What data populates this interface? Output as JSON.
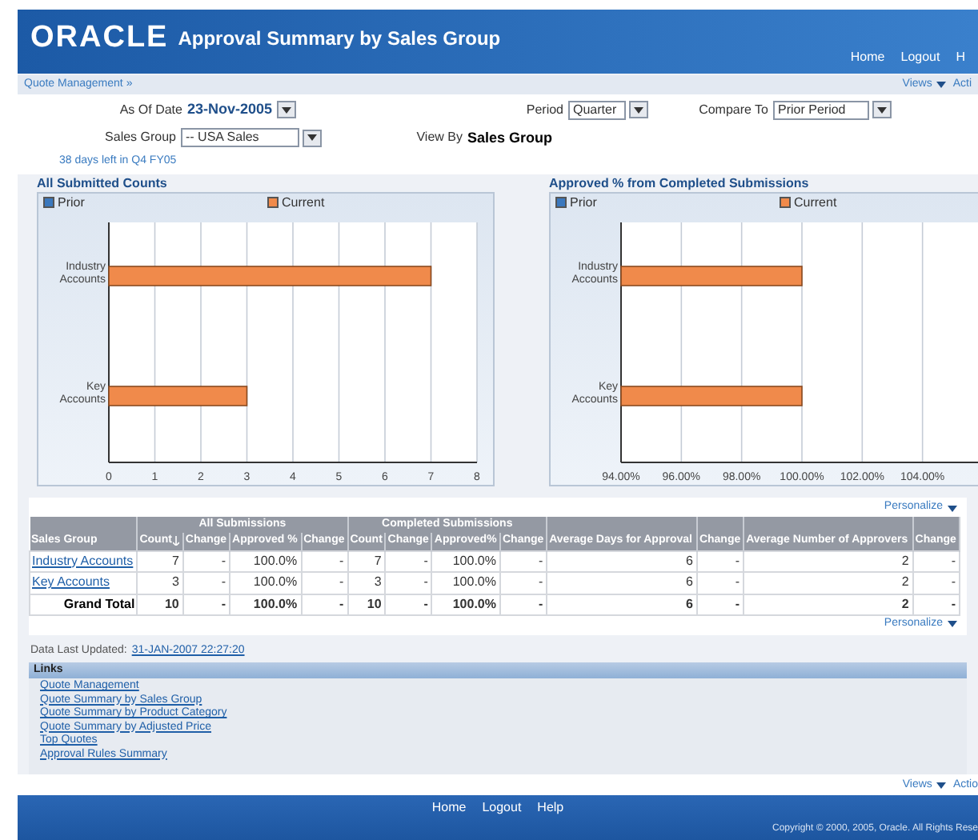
{
  "header": {
    "logo": "ORACLE",
    "title": "Approval Summary by Sales Group",
    "nav": [
      "Home",
      "Logout",
      "H"
    ]
  },
  "breadcrumb": {
    "link": "Quote Management »",
    "views": "Views",
    "actions": "Acti"
  },
  "parameters": {
    "as_of_date": {
      "label": "As Of Date",
      "value": "23-Nov-2005"
    },
    "period": {
      "label": "Period",
      "value": "Quarter"
    },
    "compare_to": {
      "label": "Compare To",
      "value": "Prior Period"
    },
    "sales_group": {
      "label": "Sales Group",
      "value": "-- USA Sales"
    },
    "view_by": {
      "label": "View By",
      "value": "Sales Group"
    }
  },
  "period_note": "38 days left in Q4 FY05",
  "charts": [
    {
      "chart_data": {
        "type": "bar",
        "orientation": "horizontal",
        "grid": true,
        "title": "All Submitted Counts",
        "categories": [
          "Industry Accounts",
          "Key Accounts"
        ],
        "series": [
          {
            "name": "Prior",
            "color": "#3b78bd",
            "values": [
              null,
              null
            ]
          },
          {
            "name": "Current",
            "color": "#f08a4b",
            "values": [
              7,
              3
            ]
          }
        ],
        "xlim": [
          0,
          8
        ],
        "xticks": [
          0,
          1,
          2,
          3,
          4,
          5,
          6,
          7,
          8
        ]
      }
    },
    {
      "chart_data": {
        "type": "bar",
        "orientation": "horizontal",
        "grid": true,
        "title": "Approved % from Completed Submissions",
        "categories": [
          "Industry Accounts",
          "Key Accounts"
        ],
        "series": [
          {
            "name": "Prior",
            "color": "#3b78bd",
            "values": [
              null,
              null
            ]
          },
          {
            "name": "Current",
            "color": "#f08a4b",
            "values": [
              100,
              100
            ]
          }
        ],
        "xlim": [
          94,
          106
        ],
        "xticks": [
          {
            "value": 94,
            "label": "94.00%"
          },
          {
            "value": 96,
            "label": "96.00%"
          },
          {
            "value": 98,
            "label": "98.00%"
          },
          {
            "value": 100,
            "label": "100.00%"
          },
          {
            "value": 102,
            "label": "102.00%"
          },
          {
            "value": 104,
            "label": "104.00%"
          }
        ]
      }
    }
  ],
  "table": {
    "personalize": "Personalize",
    "personalize_bottom": "Personalize",
    "group_headers": [
      {
        "label": "All Submissions"
      },
      {
        "label": "Completed Submissions"
      }
    ],
    "columns": [
      {
        "label": "Sales Group",
        "sorted": false,
        "grouped": false
      },
      {
        "label": "Count",
        "sorted": true,
        "grouped": true,
        "group_start": true
      },
      {
        "label": "Change",
        "sorted": false,
        "grouped": true,
        "group_start": false
      },
      {
        "label": "Approved %",
        "sorted": false,
        "grouped": true,
        "group_start": false
      },
      {
        "label": "Change",
        "sorted": false,
        "grouped": true,
        "group_start": false
      },
      {
        "label": "Count",
        "sorted": false,
        "grouped": true,
        "group_start": true
      },
      {
        "label": "Change",
        "sorted": false,
        "grouped": true,
        "group_start": false
      },
      {
        "label": "Approved%",
        "sorted": false,
        "grouped": true,
        "group_start": false
      },
      {
        "label": "Change",
        "sorted": false,
        "grouped": true,
        "group_start": false
      },
      {
        "label": "Average Days for Approval",
        "sorted": false,
        "grouped": false
      },
      {
        "label": "Change",
        "sorted": false,
        "grouped": false
      },
      {
        "label": "Average Number of Approvers",
        "sorted": false,
        "grouped": false
      },
      {
        "label": "Change",
        "sorted": false,
        "grouped": false
      }
    ],
    "rows": [
      {
        "kind": "data",
        "cells": [
          "Industry Accounts",
          "7",
          "-",
          "100.0%",
          "-",
          "7",
          "-",
          "100.0%",
          "-",
          "6",
          "-",
          "2",
          "-"
        ]
      },
      {
        "kind": "data",
        "cells": [
          "Key Accounts",
          "3",
          "-",
          "100.0%",
          "-",
          "3",
          "-",
          "100.0%",
          "-",
          "6",
          "-",
          "2",
          "-"
        ]
      },
      {
        "kind": "total",
        "cells": [
          "Grand Total",
          "10",
          "-",
          "100.0%",
          "-",
          "10",
          "-",
          "100.0%",
          "-",
          "6",
          "-",
          "2",
          "-"
        ]
      }
    ]
  },
  "data_updated": {
    "label": "Data Last Updated:",
    "value": "31-JAN-2007 22:27:20"
  },
  "links": {
    "title": "Links",
    "items": [
      "Quote Management",
      "Quote Summary by Sales Group",
      "Quote Summary by Product Category",
      "Quote Summary by Adjusted Price",
      "Top Quotes",
      "Approval Rules Summary"
    ]
  },
  "bottom_bar": {
    "views": "Views",
    "actions": "Actio"
  },
  "footer": {
    "nav": [
      "Home",
      "Logout",
      "Help"
    ],
    "copyright": "Copyright © 2000, 2005, Oracle. All Rights Rese"
  }
}
